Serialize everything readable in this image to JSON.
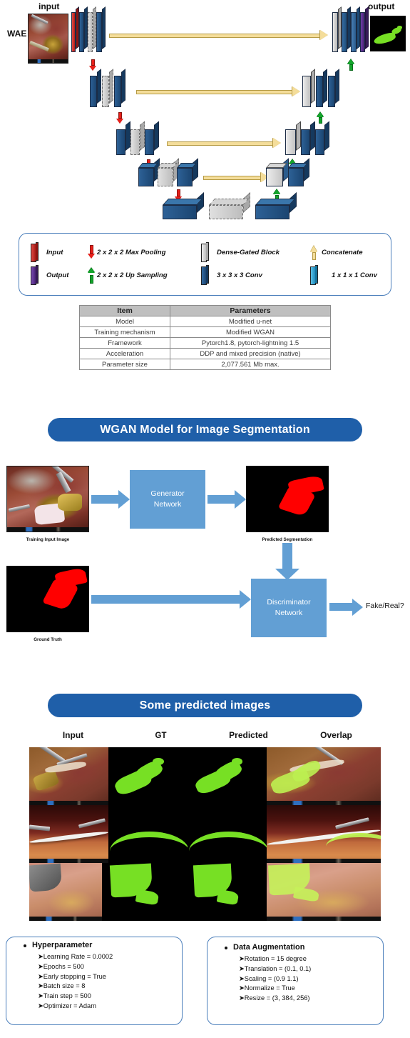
{
  "unet": {
    "input_label": "input",
    "output_label": "output",
    "model_label": "WAE",
    "input_image_alt": "laparoscopic-surgery-frame",
    "output_image_alt": "green-segmentation-mask"
  },
  "legend": {
    "items": [
      {
        "icon": "input-slab-icon",
        "label": "Input",
        "color": "#c1272d"
      },
      {
        "icon": "output-slab-icon",
        "label": "Output",
        "color": "#5b3090"
      },
      {
        "icon": "red-down-arrow-icon",
        "label": "2 x 2 x 2 Max Pooling",
        "color": "#e8201a"
      },
      {
        "icon": "green-up-arrow-icon",
        "label": "2 x 2 x 2 Up Sampling",
        "color": "#13a52b"
      },
      {
        "icon": "gray-slab-icon",
        "label": "Dense-Gated Block",
        "color": "#c9c9c9"
      },
      {
        "icon": "darkblue-slab-icon",
        "label": "3 x 3 x 3 Conv",
        "color": "#1f4e79"
      },
      {
        "icon": "yellow-up-arrow-icon",
        "label": "Concatenate",
        "color": "#f4dd9a"
      },
      {
        "icon": "cyan-slab-icon",
        "label": "1 x 1 x 1 Conv",
        "color": "#2a9fd0"
      }
    ]
  },
  "spec_table": {
    "headers": [
      "Item",
      "Parameters"
    ],
    "rows": [
      [
        "Model",
        "Modified u-net"
      ],
      [
        "Training mechanism",
        "Modified WGAN"
      ],
      [
        "Framework",
        "Pytorch1.8, pytorch-lightning 1.5"
      ],
      [
        "Acceleration",
        "DDP and mixed precision (native)"
      ],
      [
        "Parameter size",
        "2,077.561 Mb max."
      ]
    ]
  },
  "wgan": {
    "banner": "WGAN Model for Image Segmentation",
    "generator": "Generator\nNetwork",
    "generator_line1": "Generator",
    "generator_line2": "Network",
    "discriminator_line1": "Discriminator",
    "discriminator_line2": "Network",
    "caption_training_input": "Training Input Image",
    "caption_predicted": "Predicted Segmentation",
    "caption_ground_truth": "Ground Truth",
    "output_text": "Fake/Real?",
    "accent_color": "#629fd4",
    "mask_color": "#ff0000"
  },
  "predicted": {
    "banner": "Some predicted images",
    "columns": [
      "Input",
      "GT",
      "Predicted",
      "Overlap"
    ],
    "rows": 3,
    "mask_color": "#77e024"
  },
  "hyperparameter_box": {
    "title": "Hyperparameter",
    "items": [
      "Learning Rate = 0.0002",
      "Epochs = 500",
      "Early stopping = True",
      "Batch size = 8",
      "Train step = 500",
      "Optimizer = Adam"
    ]
  },
  "augmentation_box": {
    "title": "Data Augmentation",
    "items": [
      "Rotation = 15 degree",
      "Translation = (0.1, 0.1)",
      "Scaling = (0.9 1.1)",
      "Normalize = True",
      "Resize = (3, 384, 256)"
    ]
  },
  "colors": {
    "banner_blue": "#1f5fa9",
    "box_border_blue": "#4a7ebb",
    "conv_blue": "#1f4e79",
    "dense_gray": "#c9c9c9",
    "concat_yellow": "#f4dd9a",
    "pool_red": "#e8201a",
    "upsample_green": "#13a52b"
  }
}
